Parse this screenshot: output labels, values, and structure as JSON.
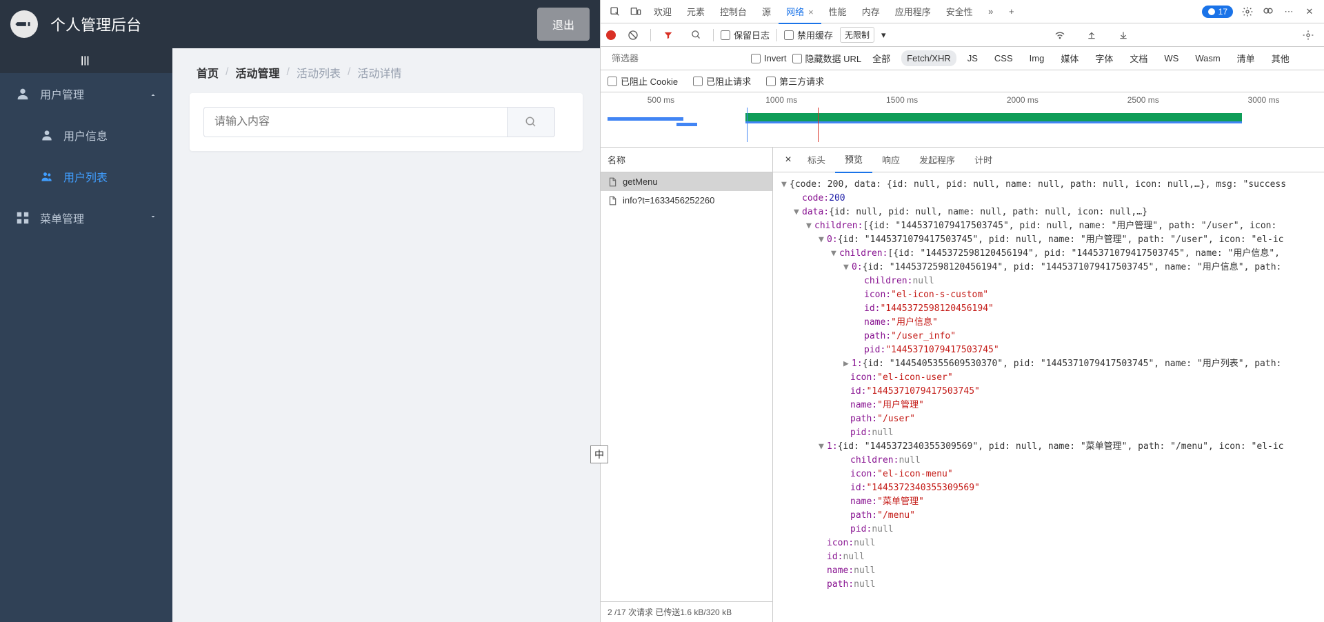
{
  "admin": {
    "title": "个人管理后台",
    "logout": "退出",
    "sidebar": {
      "menu1": "用户管理",
      "menu1_item1": "用户信息",
      "menu1_item2": "用户列表",
      "menu2": "菜单管理"
    },
    "breadcrumb": {
      "b1": "首页",
      "b2": "活动管理",
      "b3": "活动列表",
      "b4": "活动详情"
    },
    "search_placeholder": "请输入内容",
    "ime": "中"
  },
  "devtools": {
    "tabs": {
      "welcome": "欢迎",
      "elements": "元素",
      "console": "控制台",
      "sources": "源",
      "network": "网络",
      "performance": "性能",
      "memory": "内存",
      "application": "应用程序",
      "security": "安全性"
    },
    "issue_count": "17",
    "toolbar": {
      "preserve_log": "保留日志",
      "disable_cache": "禁用缓存",
      "throttle": "无限制"
    },
    "filterbar": {
      "filter_placeholder": "筛选器",
      "invert": "Invert",
      "hide_data_url": "隐藏数据 URL",
      "all": "全部",
      "fetch_xhr": "Fetch/XHR",
      "js": "JS",
      "css": "CSS",
      "img": "Img",
      "media": "媒体",
      "font": "字体",
      "doc": "文档",
      "ws": "WS",
      "wasm": "Wasm",
      "manifest": "清单",
      "other": "其他"
    },
    "blockbar": {
      "block_cookie": "已阻止 Cookie",
      "block_req": "已阻止请求",
      "third_party": "第三方请求"
    },
    "timeline": {
      "t1": "500 ms",
      "t2": "1000 ms",
      "t3": "1500 ms",
      "t4": "2000 ms",
      "t5": "2500 ms",
      "t6": "3000 ms"
    },
    "reqlist": {
      "header": "名称",
      "r1": "getMenu",
      "r2": "info?t=1633456252260",
      "status": "2 /17 次请求  已传送1.6 kB/320 kB"
    },
    "detail_tabs": {
      "headers": "标头",
      "preview": "预览",
      "response": "响应",
      "initiator": "发起程序",
      "timing": "计时"
    },
    "preview": {
      "root": "{code: 200, data: {id: null, pid: null, name: null, path: null, icon: null,…}, msg: \"success",
      "code_k": "code:",
      "code_v": "200",
      "data_k": "data:",
      "data_v": "{id: null, pid: null, name: null, path: null, icon: null,…}",
      "children_k": "children:",
      "children_v": "[{id: \"1445371079417503745\", pid: null, name: \"用户管理\", path: \"/user\", icon:",
      "i0_k": "0:",
      "i0_v": "{id: \"1445371079417503745\", pid: null, name: \"用户管理\", path: \"/user\", icon: \"el-ic",
      "i0_children_k": "children:",
      "i0_children_v": "[{id: \"1445372598120456194\", pid: \"1445371079417503745\", name: \"用户信息\",",
      "i00_k": "0:",
      "i00_v": "{id: \"1445372598120456194\", pid: \"1445371079417503745\", name: \"用户信息\", path:",
      "i00_children_k": "children:",
      "i00_children_v": "null",
      "i00_icon_k": "icon:",
      "i00_icon_v": "\"el-icon-s-custom\"",
      "i00_id_k": "id:",
      "i00_id_v": "\"1445372598120456194\"",
      "i00_name_k": "name:",
      "i00_name_v": "\"用户信息\"",
      "i00_path_k": "path:",
      "i00_path_v": "\"/user_info\"",
      "i00_pid_k": "pid:",
      "i00_pid_v": "\"1445371079417503745\"",
      "i01_k": "1:",
      "i01_v": "{id: \"1445405355609530370\", pid: \"1445371079417503745\", name: \"用户列表\", path:",
      "i0_icon_k": "icon:",
      "i0_icon_v": "\"el-icon-user\"",
      "i0_id_k": "id:",
      "i0_id_v": "\"1445371079417503745\"",
      "i0_name_k": "name:",
      "i0_name_v": "\"用户管理\"",
      "i0_path_k": "path:",
      "i0_path_v": "\"/user\"",
      "i0_pid_k": "pid:",
      "i0_pid_v": "null",
      "i1_k": "1:",
      "i1_v": "{id: \"1445372340355309569\", pid: null, name: \"菜单管理\", path: \"/menu\", icon: \"el-ic",
      "i1_children_k": "children:",
      "i1_children_v": "null",
      "i1_icon_k": "icon:",
      "i1_icon_v": "\"el-icon-menu\"",
      "i1_id_k": "id:",
      "i1_id_v": "\"1445372340355309569\"",
      "i1_name_k": "name:",
      "i1_name_v": "\"菜单管理\"",
      "i1_path_k": "path:",
      "i1_path_v": "\"/menu\"",
      "i1_pid_k": "pid:",
      "i1_pid_v": "null",
      "d_icon_k": "icon:",
      "d_icon_v": "null",
      "d_id_k": "id:",
      "d_id_v": "null",
      "d_name_k": "name:",
      "d_name_v": "null",
      "d_path_k": "path:",
      "d_path_v": "null"
    }
  }
}
